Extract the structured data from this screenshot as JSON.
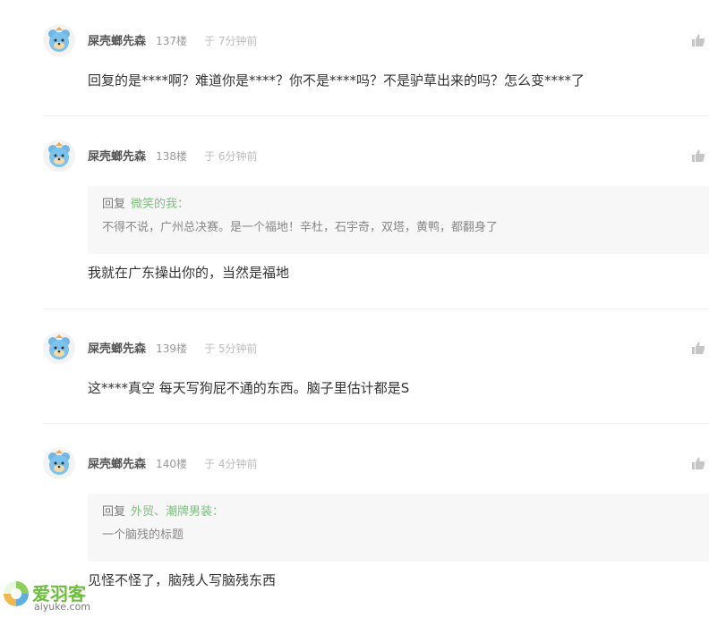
{
  "comments": [
    {
      "username": "屎壳螂先森",
      "floor": "137楼",
      "time": "于 7分钟前",
      "text": "回复的是****啊？难道你是****？你不是****吗？不是驴草出来的吗？怎么变****了"
    },
    {
      "username": "屎壳螂先森",
      "floor": "138楼",
      "time": "于 6分钟前",
      "quote": {
        "prefix": "回复",
        "user": "微笑的我：",
        "text": "不得不说，广州总决赛。是一个福地！辛杜，石宇奇，双塔，黄鸭，都翻身了"
      },
      "text": "我就在广东操出你的，当然是福地"
    },
    {
      "username": "屎壳螂先森",
      "floor": "139楼",
      "time": "于 5分钟前",
      "text": "这****真空 每天写狗屁不通的东西。脑子里估计都是S"
    },
    {
      "username": "屎壳螂先森",
      "floor": "140楼",
      "time": "于 4分钟前",
      "quote": {
        "prefix": "回复",
        "user": "外贸、潮牌男装：",
        "text": "一个脑残的标题"
      },
      "text": "见怪不怪了，脑残人写脑残东西"
    }
  ],
  "watermark": {
    "name": "爱羽客",
    "url": "aiyuke.com"
  },
  "icons": {
    "avatar": "bear-avatar-icon",
    "like": "thumbs-up-icon"
  },
  "colors": {
    "reply_user": "#7fbf7f",
    "watermark": "#6cbd3b"
  }
}
